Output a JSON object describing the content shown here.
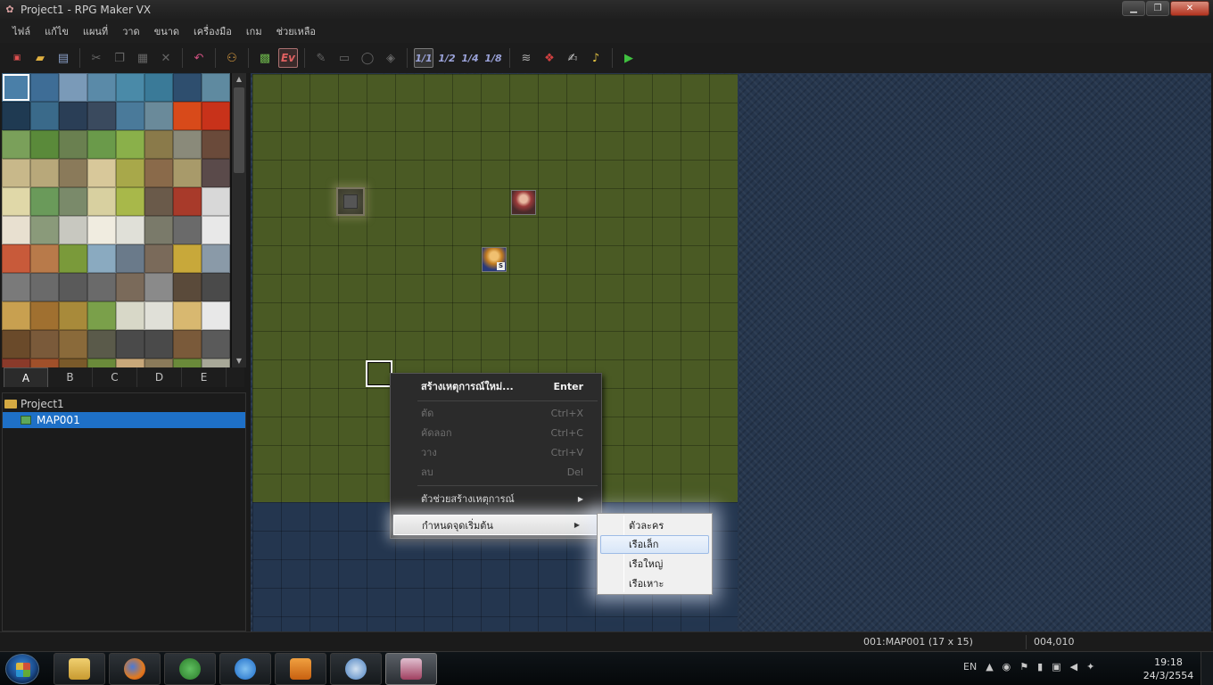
{
  "window": {
    "title": "Project1 - RPG Maker VX"
  },
  "menu": [
    "ไฟล์",
    "แก้ไข",
    "แผนที่",
    "วาด",
    "ขนาด",
    "เครื่องมือ",
    "เกม",
    "ช่วยเหลือ"
  ],
  "toolbar": {
    "scales": [
      "1/1",
      "1/2",
      "1/4",
      "1/8"
    ],
    "ev_label": "Ev"
  },
  "palette": {
    "tabs": [
      "A",
      "B",
      "C",
      "D",
      "E"
    ],
    "active_tab": "A",
    "tile_colors": [
      "#4a7fa8",
      "#3e6d96",
      "#7a9ab8",
      "#5a8aa8",
      "#4a8aa8",
      "#3a7a98",
      "#2e4e6e",
      "#5f8aa0",
      "#1f3a52",
      "#3a6a8a",
      "#2a3e56",
      "#3a4a5e",
      "#4a7a9a",
      "#6a8a9a",
      "#d84a1a",
      "#c8321a",
      "#7aa05a",
      "#5a8a3a",
      "#6a8050",
      "#6a9a4a",
      "#8ab04a",
      "#8a7a4a",
      "#8a8a7a",
      "#6a4a3a",
      "#c8b88a",
      "#b8a87a",
      "#8a7a5a",
      "#d8c89a",
      "#a8a84a",
      "#8a6a4a",
      "#a89a6a",
      "#5a4a4a",
      "#e0d8a8",
      "#6a9a5a",
      "#7a8a6a",
      "#d8d0a0",
      "#a8b84a",
      "#6a5a4a",
      "#a83a2a",
      "#d8d8d8",
      "#e8e0d0",
      "#8a9a7a",
      "#c8c8c0",
      "#f0ece0",
      "#e0e0d8",
      "#7a7a6a",
      "#6a6a6a",
      "#e8e8e8",
      "#c85a3a",
      "#b87a4a",
      "#7a9a3a",
      "#8aaac0",
      "#6a7a8a",
      "#7a6a5a",
      "#c8a83a",
      "#8a9aa8",
      "#7a7a7a",
      "#6a6a6a",
      "#5a5a5a",
      "#6a6a6a",
      "#7a6a5a",
      "#8a8a8a",
      "#5a4a3a",
      "#4a4a4a",
      "#c8a050",
      "#a07030",
      "#a88a3a",
      "#7aa04a",
      "#d8d8c8",
      "#e0e0d8",
      "#d8b870",
      "#e8e8e8",
      "#6a4a2a",
      "#7a5a3a",
      "#8a6a3a",
      "#5a5a4a",
      "#4a4a4a",
      "#4a4a4a",
      "#7a5a3a",
      "#5a5a5a",
      "#8a3a2a",
      "#a0502a",
      "#7a5a2a",
      "#6a8a3a",
      "#c8a87a",
      "#8a7a5a",
      "#6a8a3a",
      "#a8a898"
    ]
  },
  "tree": {
    "project": "Project1",
    "maps": [
      "MAP001"
    ]
  },
  "context_menu": {
    "new_event": "สร้างเหตุการณ์ใหม่...",
    "new_event_shortcut": "Enter",
    "cut": "ตัด",
    "cut_shortcut": "Ctrl+X",
    "copy": "คัดลอก",
    "copy_shortcut": "Ctrl+C",
    "paste": "วาง",
    "paste_shortcut": "Ctrl+V",
    "delete": "ลบ",
    "delete_shortcut": "Del",
    "event_helper": "ตัวช่วยสร้างเหตุการณ์",
    "set_start": "กำหนดจุดเริ่มต้น"
  },
  "submenu": [
    "ตัวละคร",
    "เรือเล็ก",
    "เรือใหญ่",
    "เรือเหาะ"
  ],
  "submenu_selected": "เรือเล็ก",
  "status": {
    "map": "001:MAP001 (17 x 15)",
    "coord": "004,010"
  },
  "taskbar": {
    "lang": "EN",
    "time": "19:18",
    "date": "24/3/2554"
  }
}
